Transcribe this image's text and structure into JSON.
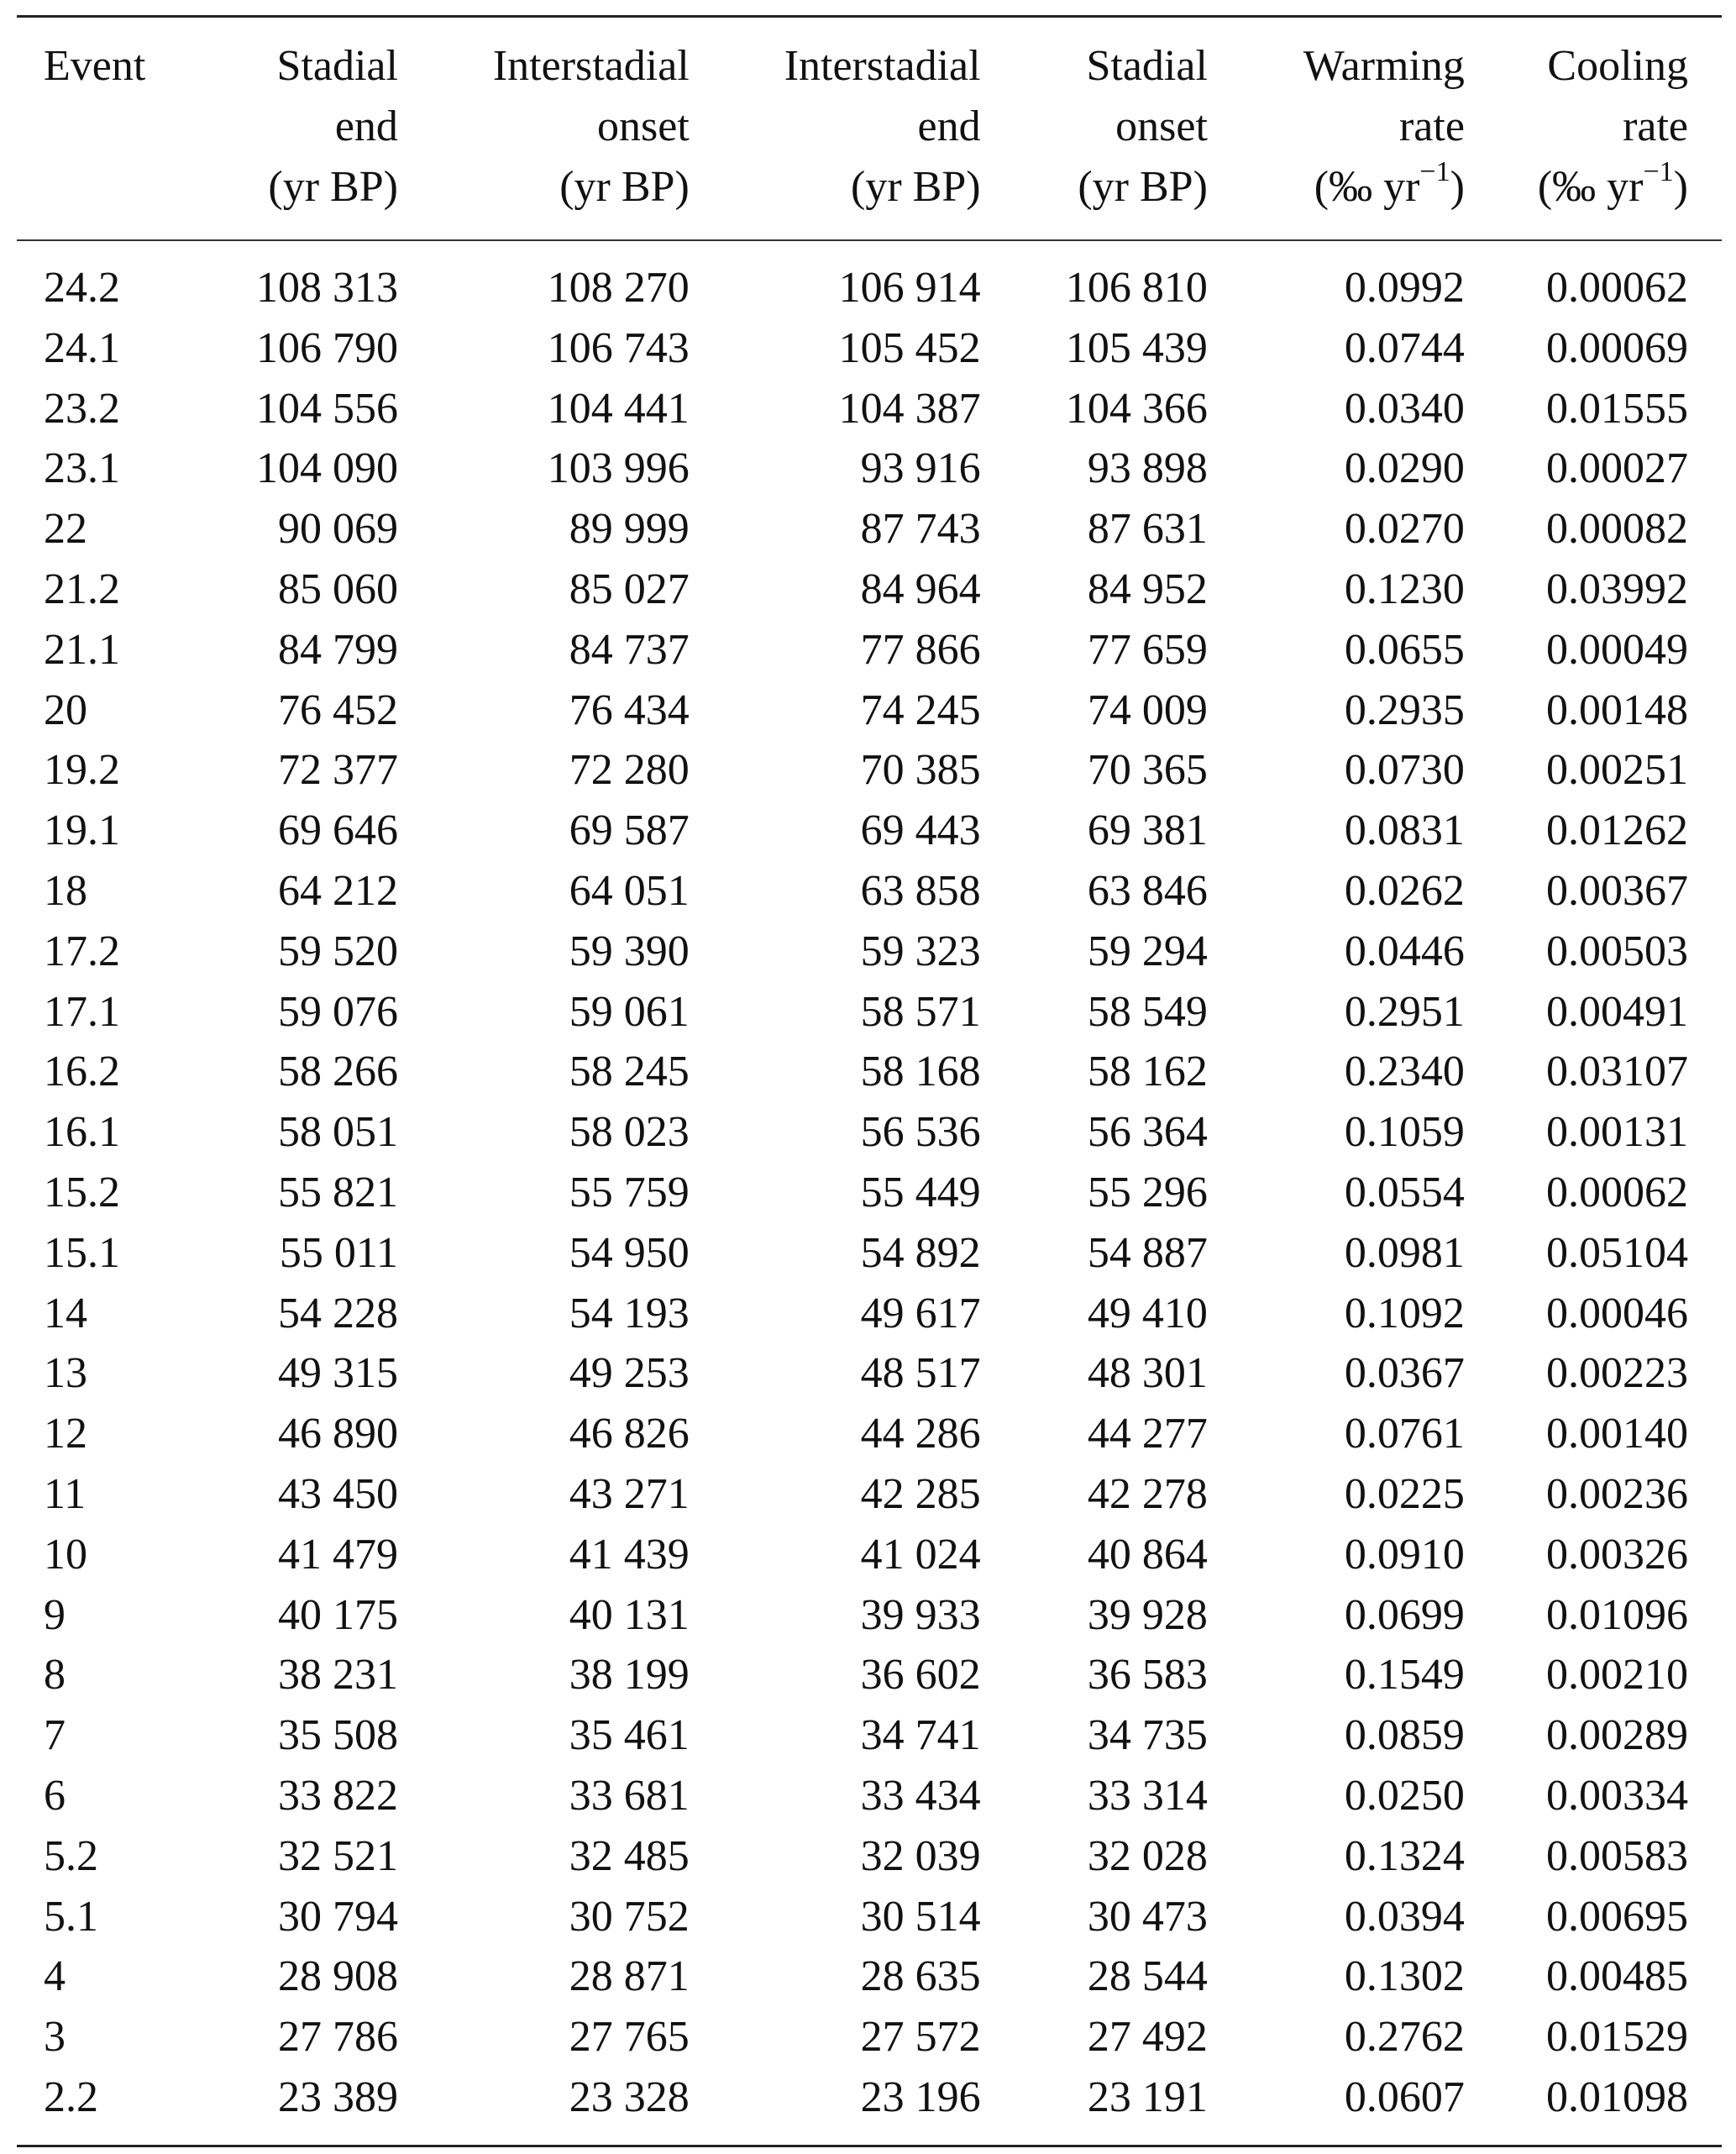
{
  "table": {
    "columns": [
      {
        "lines": [
          "Event"
        ]
      },
      {
        "lines": [
          "Stadial",
          "end",
          "(yr BP)"
        ]
      },
      {
        "lines": [
          "Interstadial",
          "onset",
          "(yr BP)"
        ]
      },
      {
        "lines": [
          "Interstadial",
          "end",
          "(yr BP)"
        ]
      },
      {
        "lines": [
          "Stadial",
          "onset",
          "(yr BP)"
        ]
      },
      {
        "lines": [
          "Warming",
          "rate"
        ],
        "unit_prefix": "(‰ yr",
        "unit_sup": "−1",
        "unit_suffix": ")"
      },
      {
        "lines": [
          "Cooling",
          "rate"
        ],
        "unit_prefix": "(‰ yr",
        "unit_sup": "−1",
        "unit_suffix": ")"
      }
    ],
    "rows": [
      [
        "24.2",
        "108 313",
        "108 270",
        "106 914",
        "106 810",
        "0.0992",
        "0.00062"
      ],
      [
        "24.1",
        "106 790",
        "106 743",
        "105 452",
        "105 439",
        "0.0744",
        "0.00069"
      ],
      [
        "23.2",
        "104 556",
        "104 441",
        "104 387",
        "104 366",
        "0.0340",
        "0.01555"
      ],
      [
        "23.1",
        "104 090",
        "103 996",
        "93 916",
        "93 898",
        "0.0290",
        "0.00027"
      ],
      [
        "22",
        "90 069",
        "89 999",
        "87 743",
        "87 631",
        "0.0270",
        "0.00082"
      ],
      [
        "21.2",
        "85 060",
        "85 027",
        "84 964",
        "84 952",
        "0.1230",
        "0.03992"
      ],
      [
        "21.1",
        "84 799",
        "84 737",
        "77 866",
        "77 659",
        "0.0655",
        "0.00049"
      ],
      [
        "20",
        "76 452",
        "76 434",
        "74 245",
        "74 009",
        "0.2935",
        "0.00148"
      ],
      [
        "19.2",
        "72 377",
        "72 280",
        "70 385",
        "70 365",
        "0.0730",
        "0.00251"
      ],
      [
        "19.1",
        "69 646",
        "69 587",
        "69 443",
        "69 381",
        "0.0831",
        "0.01262"
      ],
      [
        "18",
        "64 212",
        "64 051",
        "63 858",
        "63 846",
        "0.0262",
        "0.00367"
      ],
      [
        "17.2",
        "59 520",
        "59 390",
        "59 323",
        "59 294",
        "0.0446",
        "0.00503"
      ],
      [
        "17.1",
        "59 076",
        "59 061",
        "58 571",
        "58 549",
        "0.2951",
        "0.00491"
      ],
      [
        "16.2",
        "58 266",
        "58 245",
        "58 168",
        "58 162",
        "0.2340",
        "0.03107"
      ],
      [
        "16.1",
        "58 051",
        "58 023",
        "56 536",
        "56 364",
        "0.1059",
        "0.00131"
      ],
      [
        "15.2",
        "55 821",
        "55 759",
        "55 449",
        "55 296",
        "0.0554",
        "0.00062"
      ],
      [
        "15.1",
        "55 011",
        "54 950",
        "54 892",
        "54 887",
        "0.0981",
        "0.05104"
      ],
      [
        "14",
        "54 228",
        "54 193",
        "49 617",
        "49 410",
        "0.1092",
        "0.00046"
      ],
      [
        "13",
        "49 315",
        "49 253",
        "48 517",
        "48 301",
        "0.0367",
        "0.00223"
      ],
      [
        "12",
        "46 890",
        "46 826",
        "44 286",
        "44 277",
        "0.0761",
        "0.00140"
      ],
      [
        "11",
        "43 450",
        "43 271",
        "42 285",
        "42 278",
        "0.0225",
        "0.00236"
      ],
      [
        "10",
        "41 479",
        "41 439",
        "41 024",
        "40 864",
        "0.0910",
        "0.00326"
      ],
      [
        "9",
        "40 175",
        "40 131",
        "39 933",
        "39 928",
        "0.0699",
        "0.01096"
      ],
      [
        "8",
        "38 231",
        "38 199",
        "36 602",
        "36 583",
        "0.1549",
        "0.00210"
      ],
      [
        "7",
        "35 508",
        "35 461",
        "34 741",
        "34 735",
        "0.0859",
        "0.00289"
      ],
      [
        "6",
        "33 822",
        "33 681",
        "33 434",
        "33 314",
        "0.0250",
        "0.00334"
      ],
      [
        "5.2",
        "32 521",
        "32 485",
        "32 039",
        "32 028",
        "0.1324",
        "0.00583"
      ],
      [
        "5.1",
        "30 794",
        "30 752",
        "30 514",
        "30 473",
        "0.0394",
        "0.00695"
      ],
      [
        "4",
        "28 908",
        "28 871",
        "28 635",
        "28 544",
        "0.1302",
        "0.00485"
      ],
      [
        "3",
        "27 786",
        "27 765",
        "27 572",
        "27 492",
        "0.2762",
        "0.01529"
      ],
      [
        "2.2",
        "23 389",
        "23 328",
        "23 196",
        "23 191",
        "0.0607",
        "0.01098"
      ]
    ]
  }
}
